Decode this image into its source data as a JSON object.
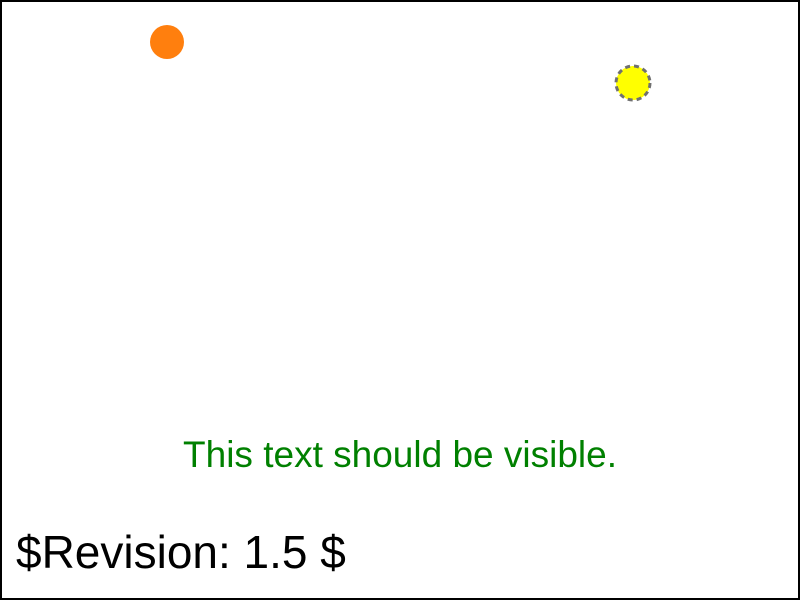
{
  "scene": {
    "message": "This text should be visible.",
    "revision": "$Revision: 1.5 $"
  },
  "colors": {
    "background": "#ffffff",
    "frame": "#000000",
    "orange_dot": "#ff7f0e",
    "yellow_dot_fill": "#ffff00",
    "yellow_dot_stroke": "#707070",
    "message_text": "#008000",
    "revision_text": "#000000"
  }
}
